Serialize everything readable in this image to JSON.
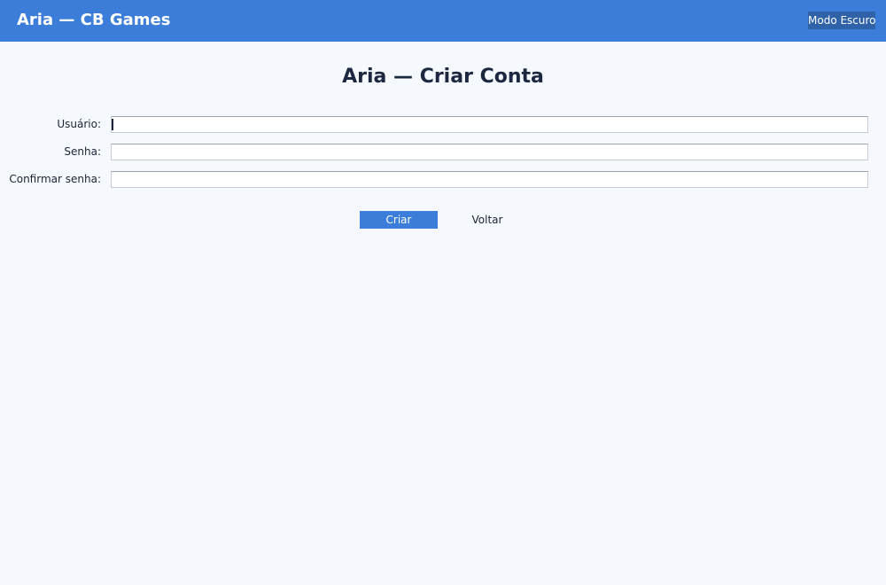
{
  "header": {
    "app_title": "Aria — CB Games",
    "dark_mode_label": "Modo Escuro",
    "background_color": "#3b7dd8"
  },
  "main": {
    "page_title": "Aria — Criar Conta",
    "fields": [
      {
        "label": "Usuário:",
        "value": "",
        "placeholder": ""
      },
      {
        "label": "Senha:",
        "value": "",
        "placeholder": ""
      },
      {
        "label": "Confirmar senha:",
        "value": "",
        "placeholder": ""
      }
    ],
    "create_label": "Criar",
    "back_label": "Voltar",
    "accent_color": "#3b7dd8"
  }
}
